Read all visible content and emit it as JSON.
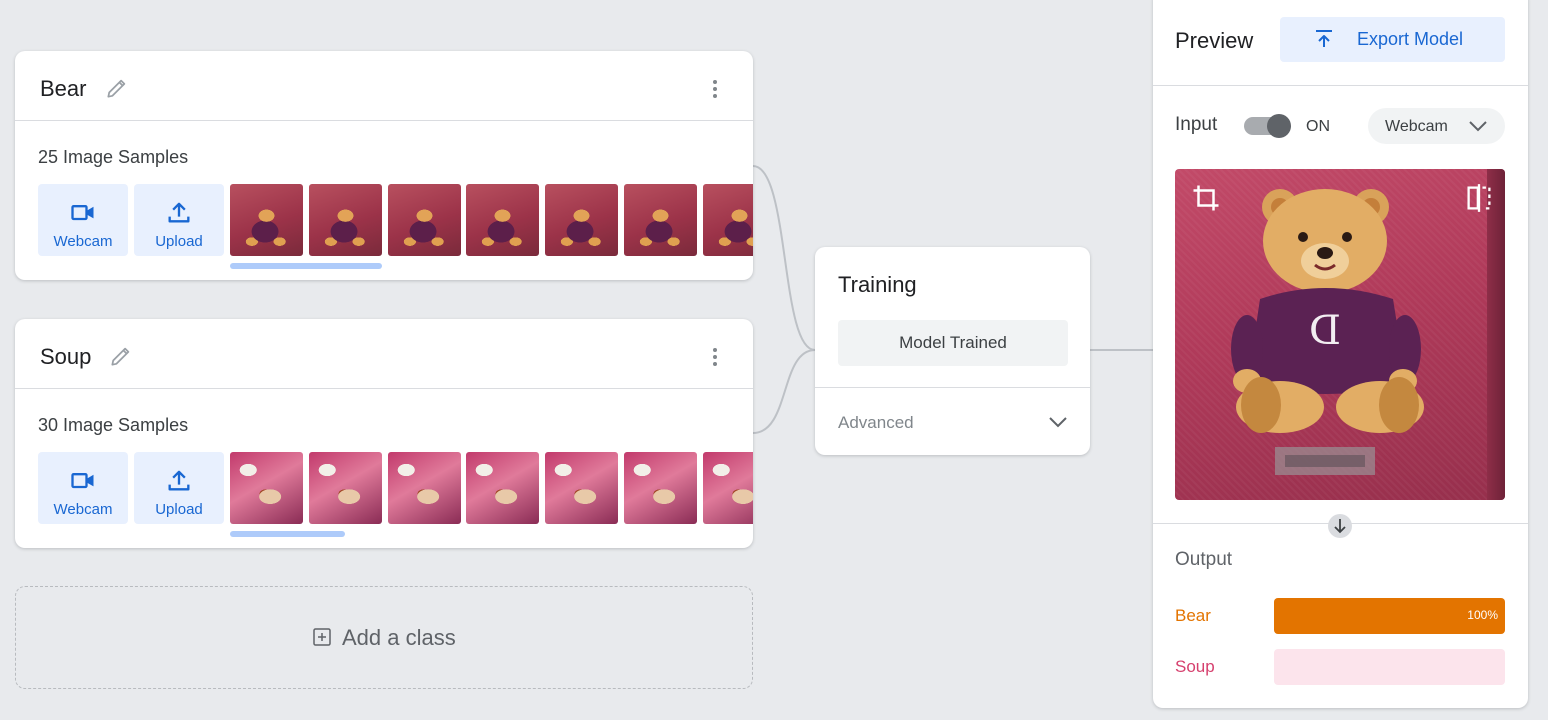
{
  "classes": [
    {
      "name": "Bear",
      "sample_count": "25 Image Samples",
      "webcam_label": "Webcam",
      "upload_label": "Upload",
      "scroll_position": 0.29
    },
    {
      "name": "Soup",
      "sample_count": "30 Image Samples",
      "webcam_label": "Webcam",
      "upload_label": "Upload",
      "scroll_position": 0.22
    }
  ],
  "add_class": {
    "label": "Add a class"
  },
  "training": {
    "title": "Training",
    "status_button": "Model Trained",
    "advanced_label": "Advanced"
  },
  "preview": {
    "title": "Preview",
    "export_label": "Export Model",
    "input_label": "Input",
    "input_toggle_state": "ON",
    "input_source": "Webcam",
    "output_title": "Output",
    "outputs": [
      {
        "label": "Bear",
        "percent_text": "100%",
        "value": 1.0,
        "color": "#e37400"
      },
      {
        "label": "Soup",
        "percent_text": "",
        "value": 0.0,
        "color": "#d6406e"
      }
    ]
  },
  "colors": {
    "accent": "#1967d2",
    "accent_bg": "#e8f0fe",
    "background": "#e8eaed"
  },
  "icons": {
    "edit": "pencil-icon",
    "more": "more-vert-icon",
    "webcam": "videocam-icon",
    "upload": "upload-icon",
    "export": "upload-icon",
    "add": "add-box-icon",
    "chevron": "chevron-down-icon",
    "crop": "crop-icon",
    "flip": "flip-icon",
    "arrow": "arrow-down-icon"
  }
}
